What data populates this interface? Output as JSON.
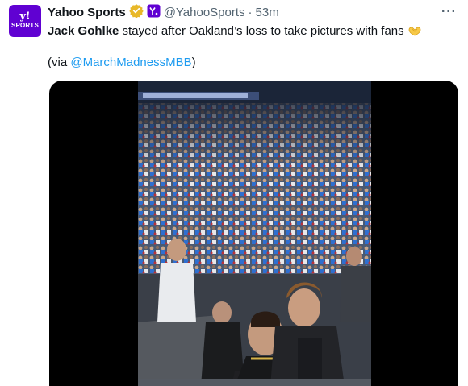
{
  "post": {
    "author_name": "Yahoo Sports",
    "handle": "@YahooSports",
    "separator": "·",
    "time": "53m",
    "avatar_line1": "y!",
    "avatar_line2": "SPORTS",
    "more": "···",
    "text_bold": "Jack Gohlke",
    "text_rest": " stayed after Oakland’s loss to take pictures with fans ",
    "emoji": "heart-hands",
    "via_prefix": "(via ",
    "via_link": "@MarchMadnessMBB",
    "via_suffix": ")"
  },
  "colors": {
    "brand": "#6001d2",
    "verified": "#e8b829",
    "link": "#1d9bf0",
    "muted": "#536471"
  }
}
